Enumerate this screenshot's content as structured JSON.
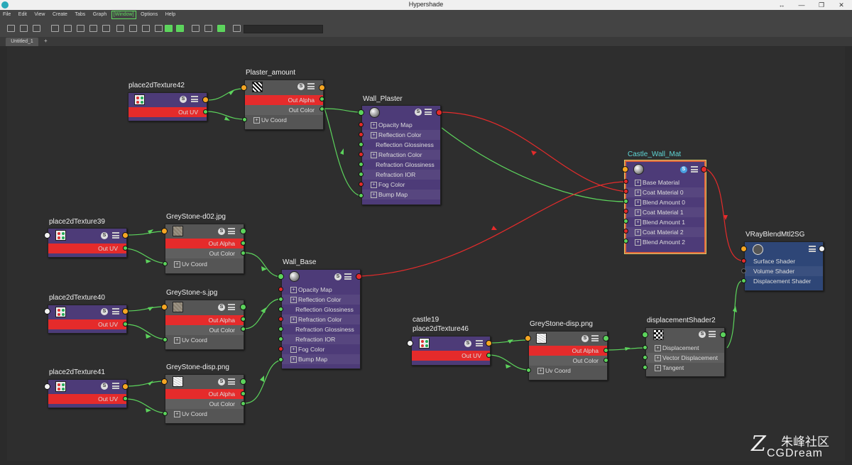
{
  "window": {
    "title": "Hypershade"
  },
  "menu": [
    "File",
    "Edit",
    "View",
    "Create",
    "Tabs",
    "Graph",
    "Window",
    "Options",
    "Help"
  ],
  "menu_active": "[Window]",
  "tabs": {
    "active": "Untitled_1",
    "add": "+"
  },
  "colors": {
    "purple_node": "#4d3b78",
    "gray_node": "#555555",
    "blue_node": "#2e4677",
    "link_green": "#5cd35c",
    "link_red": "#e52b2b",
    "port_orange": "#f5a623"
  },
  "nodes": {
    "p2d42": {
      "title": "place2dTexture42",
      "out_uv": "Out UV"
    },
    "plaster_amount": {
      "title": "Plaster_amount",
      "out_alpha": "Out Alpha",
      "out_color": "Out Color",
      "uv": "Uv Coord"
    },
    "wall_plaster": {
      "title": "Wall_Plaster",
      "attrs": [
        "Opacity Map",
        "Reflection Color",
        "Reflection Glossiness",
        "Refraction Color",
        "Refraction Glossiness",
        "Refraction IOR",
        "Fog Color",
        "Bump Map"
      ]
    },
    "castle_wall_mat": {
      "title": "Castle_Wall_Mat",
      "attrs": [
        "Base Material",
        "Coat Material 0",
        "Blend Amount 0",
        "Coat Material 1",
        "Blend Amount 1",
        "Coat Material 2",
        "Blend Amount 2"
      ]
    },
    "p2d39": {
      "title": "place2dTexture39",
      "out_uv": "Out UV"
    },
    "greystone_d02": {
      "title": "GreyStone-d02.jpg",
      "out_alpha": "Out Alpha",
      "out_color": "Out Color",
      "uv": "Uv Coord"
    },
    "wall_base": {
      "title": "Wall_Base",
      "attrs": [
        "Opacity Map",
        "Reflection Color",
        "Reflection Glossiness",
        "Refraction Color",
        "Refraction Glossiness",
        "Refraction IOR",
        "Fog Color",
        "Bump Map"
      ]
    },
    "vray_sg": {
      "title": "VRayBlendMtl2SG",
      "attrs": [
        "Surface Shader",
        "Volume Shader",
        "Displacement Shader"
      ]
    },
    "p2d40": {
      "title": "place2dTexture40",
      "out_uv": "Out UV"
    },
    "greystone_s": {
      "title": "GreyStone-s.jpg",
      "out_alpha": "Out Alpha",
      "out_color": "Out Color",
      "uv": "Uv Coord"
    },
    "p2d41": {
      "title": "place2dTexture41",
      "out_uv": "Out UV"
    },
    "greystone_disp_a": {
      "title": "GreyStone-disp.png",
      "out_alpha": "Out Alpha",
      "out_color": "Out Color",
      "uv": "Uv Coord"
    },
    "p2d46": {
      "title_line1": "castle19",
      "title_line2": "place2dTexture46",
      "out_uv": "Out UV"
    },
    "greystone_disp_b": {
      "title": "GreyStone-disp.png",
      "out_alpha": "Out Alpha",
      "out_color": "Out Color",
      "uv": "Uv Coord"
    },
    "disp_shader": {
      "title": "displacementShader2",
      "attrs": [
        "Displacement",
        "Vector Displacement",
        "Tangent"
      ]
    }
  },
  "watermark": {
    "cn": "朱峰社区",
    "en": "CGDream"
  }
}
